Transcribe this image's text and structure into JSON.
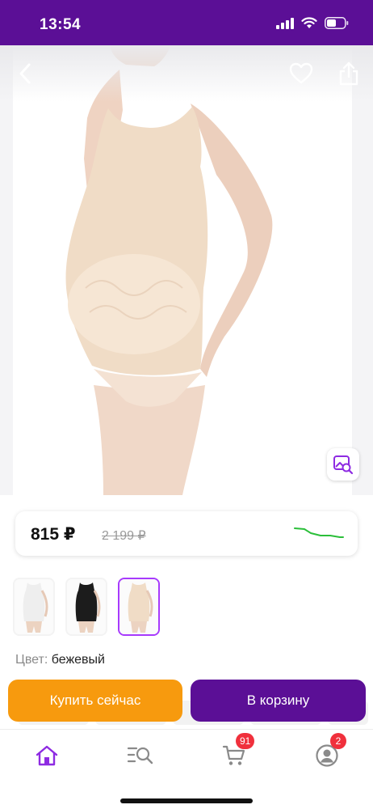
{
  "status_bar": {
    "time": "13:54",
    "icons": [
      "cellular-signal-icon",
      "wifi-icon",
      "battery-icon"
    ]
  },
  "product": {
    "image_alt": "Маечка для беременных бежевая",
    "price": "815 ₽",
    "old_price": "2 199 ₽",
    "price_trend": "down",
    "color_label": "Цвет:",
    "color_value": "бежевый",
    "variants": [
      {
        "color": "white",
        "selected": false
      },
      {
        "color": "black",
        "selected": false
      },
      {
        "color": "beige",
        "selected": true
      }
    ]
  },
  "actions": {
    "buy_now": "Купить сейчас",
    "add_to_cart": "В корзину"
  },
  "bottom_nav": {
    "items": [
      "home-icon",
      "catalog-search-icon",
      "cart-icon",
      "profile-icon"
    ],
    "cart_badge": "91",
    "profile_badge": "2"
  },
  "colors": {
    "brand_purple": "#5b0f96",
    "buy_orange": "#f79a0e",
    "badge_red": "#f0303c",
    "accent_violet": "#a73afd",
    "trend_green": "#2bbf3a"
  }
}
